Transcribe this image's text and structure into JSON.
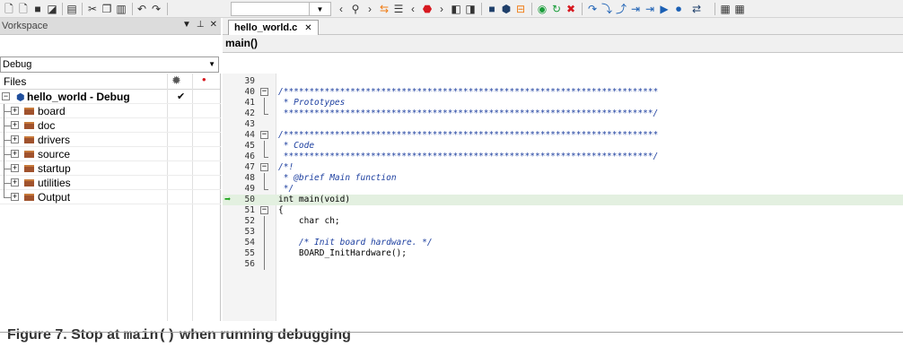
{
  "toolbar": {
    "icons": [
      "new-file-icon",
      "new-project-icon",
      "save-icon",
      "save-all-icon",
      "print-icon",
      "cut-icon",
      "copy-icon",
      "paste-icon",
      "undo-icon",
      "redo-icon",
      "search-box",
      "combo-arrow",
      "prev-icon",
      "find-icon",
      "next-icon",
      "toggle-bookmark-icon",
      "list-icon",
      "prev-bookmark-icon",
      "bookmark-icon",
      "next-bookmark-icon",
      "step-back-icon",
      "step-forward-icon",
      "compile-icon",
      "debug-download-icon",
      "layout-icon",
      "make-icon",
      "reset-icon",
      "stop-build-icon",
      "step-over-icon",
      "step-into-icon",
      "step-out-icon",
      "next-statement-icon",
      "run-to-cursor-icon",
      "go-icon",
      "break-icon",
      "debug-menu-icon",
      "windows-icon"
    ]
  },
  "workspace": {
    "title": "Vorkspace",
    "config": "Debug",
    "files_label": "Files",
    "tree": [
      {
        "label": "hello_world - Debug",
        "type": "project",
        "checked": true
      },
      {
        "label": "board",
        "type": "folder"
      },
      {
        "label": "doc",
        "type": "folder"
      },
      {
        "label": "drivers",
        "type": "folder"
      },
      {
        "label": "source",
        "type": "folder"
      },
      {
        "label": "startup",
        "type": "folder"
      },
      {
        "label": "utilities",
        "type": "folder"
      },
      {
        "label": "Output",
        "type": "folder"
      }
    ]
  },
  "editor": {
    "tab": "hello_world.c",
    "function": "main()",
    "lines": [
      {
        "n": "39",
        "code": "",
        "fold": "",
        "comment": false
      },
      {
        "n": "40",
        "code": "/*************************************************************************",
        "fold": "open",
        "comment": true
      },
      {
        "n": "41",
        "code": " * Prototypes",
        "fold": "mid",
        "comment": true
      },
      {
        "n": "42",
        "code": " ************************************************************************/",
        "fold": "end",
        "comment": true
      },
      {
        "n": "43",
        "code": "",
        "fold": "",
        "comment": false
      },
      {
        "n": "44",
        "code": "/*************************************************************************",
        "fold": "open",
        "comment": true
      },
      {
        "n": "45",
        "code": " * Code",
        "fold": "mid",
        "comment": true
      },
      {
        "n": "46",
        "code": " ************************************************************************/",
        "fold": "end",
        "comment": true
      },
      {
        "n": "47",
        "code": "/*!",
        "fold": "open",
        "comment": true
      },
      {
        "n": "48",
        "code": " * @brief Main function",
        "fold": "mid",
        "comment": true
      },
      {
        "n": "49",
        "code": " */",
        "fold": "end",
        "comment": true
      },
      {
        "n": "50",
        "code": "int main(void)",
        "fold": "",
        "comment": false,
        "current": true
      },
      {
        "n": "51",
        "code": "{",
        "fold": "open",
        "comment": false
      },
      {
        "n": "52",
        "code": "    char ch;",
        "fold": "mid",
        "comment": false
      },
      {
        "n": "53",
        "code": "",
        "fold": "mid",
        "comment": false
      },
      {
        "n": "54",
        "code": "    /* Init board hardware. */",
        "fold": "mid",
        "comment": true
      },
      {
        "n": "55",
        "code": "    BOARD_InitHardware();",
        "fold": "mid",
        "comment": false
      },
      {
        "n": "56",
        "code": "",
        "fold": "mid",
        "comment": false
      }
    ]
  },
  "caption": {
    "prefix": "Figure 7.  Stop at ",
    "mono": "main()",
    "suffix": " when running debugging"
  },
  "colors": {
    "current_line": "#e3f0e0",
    "comment": "#1e40a0",
    "arrow": "#19a319",
    "folder": "#a0522d"
  }
}
